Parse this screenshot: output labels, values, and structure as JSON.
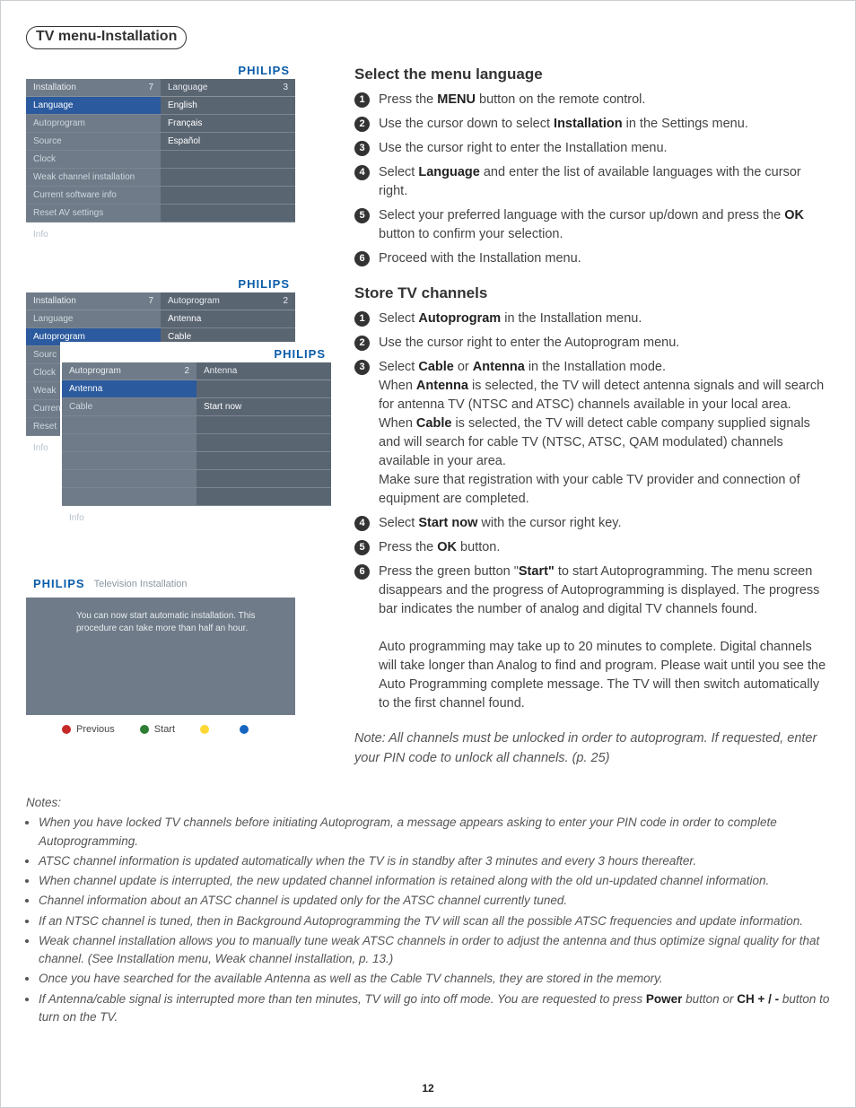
{
  "page_title": "TV menu-Installation",
  "page_number": "12",
  "brand": "PHILIPS",
  "mock1": {
    "left_header": "Installation",
    "left_count": "7",
    "right_header": "Language",
    "right_count": "3",
    "left_items": [
      "Language",
      "Autoprogram",
      "Source",
      "Clock",
      "Weak channel installation",
      "Current software info",
      "Reset AV settings"
    ],
    "right_items": [
      "English",
      "Français",
      "Español",
      "",
      "",
      "",
      ""
    ],
    "info": "Info"
  },
  "mock2a": {
    "left_header": "Installation",
    "left_count": "7",
    "right_header": "Autoprogram",
    "right_count": "2",
    "left_items": [
      "Language",
      "Autoprogram",
      "Sourc",
      "Clock",
      "Weak",
      "Curren",
      "Reset"
    ],
    "right_items": [
      "Antenna",
      "Cable",
      "",
      "",
      "",
      "",
      ""
    ],
    "info": "Info"
  },
  "mock2b": {
    "left_header": "Autoprogram",
    "left_count": "2",
    "right_header": "Antenna",
    "right_count": "",
    "left_items": [
      "Antenna",
      "Cable",
      "",
      "",
      "",
      "",
      ""
    ],
    "right_items": [
      "",
      "Start now",
      "",
      "",
      "",
      "",
      ""
    ],
    "info": "Info"
  },
  "mock3": {
    "title": "Television Installation",
    "body": "You can now start automatic installation. This procedure can take more than half an hour.",
    "legend": {
      "previous": "Previous",
      "start": "Start"
    }
  },
  "section1": {
    "heading": "Select the menu language",
    "steps": [
      {
        "pre": "Press the ",
        "bold": "MENU",
        "post": " button on the remote control."
      },
      {
        "pre": "Use the cursor down to select ",
        "bold": "Installation",
        "post": " in the Settings menu."
      },
      {
        "pre": "Use the cursor right to enter the Installation menu.",
        "bold": "",
        "post": ""
      },
      {
        "pre": "Select ",
        "bold": "Language",
        "post": " and enter the list of available languages with the cursor right."
      },
      {
        "pre": "Select your preferred language with the cursor up/down and press the ",
        "bold": "OK",
        "post": " button to confirm your selection."
      },
      {
        "pre": "Proceed with the Installation menu.",
        "bold": "",
        "post": ""
      }
    ]
  },
  "section2": {
    "heading": "Store TV channels",
    "step1": {
      "pre": "Select ",
      "bold": "Autoprogram",
      "post": " in the Installation menu."
    },
    "step2": "Use the cursor right to enter the Autoprogram menu.",
    "step3": {
      "line1_pre": "Select ",
      "line1_b1": "Cable",
      "line1_mid": " or ",
      "line1_b2": "Antenna",
      "line1_post": " in the Installation mode.",
      "line2_pre": "When ",
      "line2_b": "Antenna",
      "line2_post": " is selected, the TV will detect antenna signals and will search for antenna TV (NTSC and ATSC) channels available in your local area.",
      "line3_pre": "When ",
      "line3_b": "Cable",
      "line3_post": " is selected, the TV will detect cable company supplied signals and will search for cable TV (NTSC, ATSC, QAM modulated) channels available in your area.",
      "line4": "Make sure that registration with your cable TV provider and connection of equipment are completed."
    },
    "step4": {
      "pre": "Select ",
      "bold": "Start now",
      "post": " with the cursor right key."
    },
    "step5": {
      "pre": "Press the ",
      "bold": "OK",
      "post": " button."
    },
    "step6": {
      "line1_pre": "Press the green button \"",
      "line1_b": "Start\"",
      "line1_post": " to start Autoprogramming. The menu screen disappears and the progress of Autoprogramming is displayed. The progress bar indicates the number of analog and digital TV channels found.",
      "line2": "Auto programming may take up to 20 minutes to complete. Digital channels will take longer than Analog to find and program. Please wait until you see the Auto Programming complete message. The TV will then switch automatically to the first channel found."
    },
    "note": "Note: All channels must be unlocked in order to autoprogram. If requested, enter your PIN code to unlock all channels. (p. 25)"
  },
  "footnotes": {
    "heading": "Notes:",
    "items": [
      "When you have locked TV channels before initiating Autoprogram, a message appears asking to enter your PIN code in order to complete Autoprogramming.",
      "ATSC channel information is updated automatically when the TV is in standby after 3 minutes and every 3 hours thereafter.",
      "When channel update is interrupted, the new updated channel information is retained along with the old un-updated channel information.",
      "Channel information about an ATSC channel is updated only for the ATSC channel currently tuned.",
      "If an NTSC channel is tuned, then in Background Autoprogramming the TV will scan all the possible ATSC frequencies and update information.",
      "Weak channel installation allows you to manually tune weak ATSC channels in order to adjust the antenna and thus optimize signal quality for that channel. (See Installation menu, Weak channel installation, p. 13.)",
      "Once you have searched for the available Antenna as well as the Cable TV channels, they are stored in the memory."
    ],
    "last_pre": "If Antenna/cable signal is interrupted more than ten minutes, TV will go into off mode. You are requested to press ",
    "last_b1": "Power",
    "last_mid": " button or  ",
    "last_b2": "CH + / -",
    "last_post": " button to turn on the TV."
  }
}
